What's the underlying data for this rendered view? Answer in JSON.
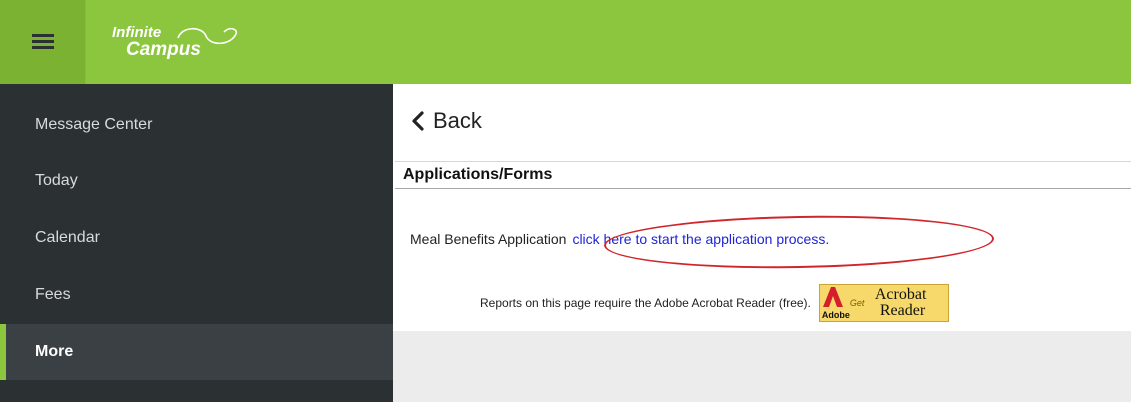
{
  "header": {
    "menu_icon": "hamburger-icon",
    "logo_line1": "Infinite",
    "logo_line2": "Campus",
    "accent_color": "#8cc63f"
  },
  "sidebar": {
    "items": [
      {
        "label": "Message Center",
        "active": false
      },
      {
        "label": "Today",
        "active": false
      },
      {
        "label": "Calendar",
        "active": false
      },
      {
        "label": "Fees",
        "active": false
      },
      {
        "label": "More",
        "active": true
      }
    ]
  },
  "main": {
    "back_label": "Back",
    "back_icon": "chevron-left-icon",
    "section_title": "Applications/Forms",
    "meal_label": "Meal Benefits Application",
    "meal_link": "click here to start the application process.",
    "reports_note": "Reports on this page require the Adobe Acrobat Reader (free).",
    "acrobat_badge": {
      "adobe": "Adobe",
      "get": "Get",
      "line1": "Acrobat",
      "line2": "Reader"
    },
    "annotation_color": "#d0262b"
  }
}
